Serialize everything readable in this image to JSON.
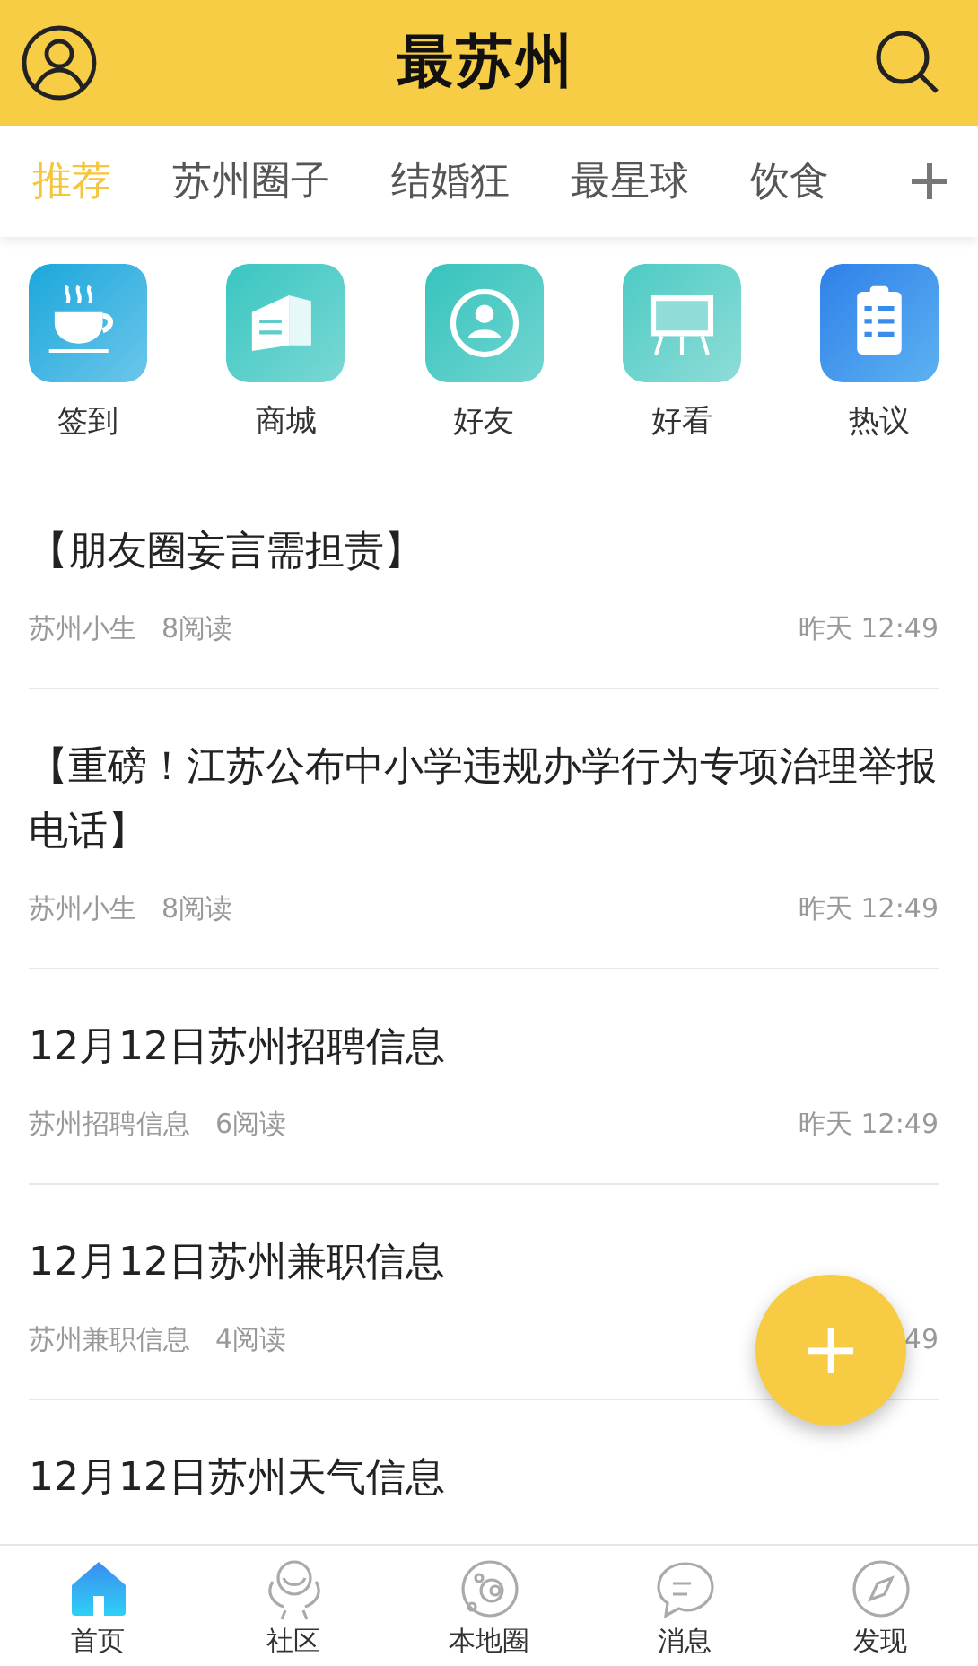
{
  "header": {
    "logo": "最苏州"
  },
  "tabs": [
    {
      "label": "推荐",
      "selected": true
    },
    {
      "label": "苏州圈子",
      "selected": false
    },
    {
      "label": "结婚狂",
      "selected": false
    },
    {
      "label": "最星球",
      "selected": false
    },
    {
      "label": "饮食",
      "selected": false
    }
  ],
  "shortcuts": [
    {
      "kind": "cup",
      "label": "签到"
    },
    {
      "kind": "shop",
      "label": "商城"
    },
    {
      "kind": "friend",
      "label": "好友"
    },
    {
      "kind": "board",
      "label": "好看"
    },
    {
      "kind": "clipboard",
      "label": "热议"
    }
  ],
  "articles": [
    {
      "title": "【朋友圈妄言需担责】",
      "author": "苏州小生",
      "reads": "8阅读",
      "time": "昨天 12:49"
    },
    {
      "title": "【重磅！江苏公布中小学违规办学行为专项治理举报电话】",
      "author": "苏州小生",
      "reads": "8阅读",
      "time": "昨天 12:49"
    },
    {
      "title": "12月12日苏州招聘信息",
      "author": "苏州招聘信息",
      "reads": "6阅读",
      "time": "昨天 12:49"
    },
    {
      "title": "12月12日苏州兼职信息",
      "author": "苏州兼职信息",
      "reads": "4阅读",
      "time": "49"
    },
    {
      "title": "12月12日苏州天气信息"
    }
  ],
  "fab": {
    "label": "+"
  },
  "bottom_nav": [
    {
      "kind": "home",
      "label": "首页",
      "selected": true
    },
    {
      "kind": "community",
      "label": "社区",
      "selected": false
    },
    {
      "kind": "local",
      "label": "本地圈",
      "selected": false
    },
    {
      "kind": "message",
      "label": "消息",
      "selected": false
    },
    {
      "kind": "discover",
      "label": "发现",
      "selected": false
    }
  ]
}
